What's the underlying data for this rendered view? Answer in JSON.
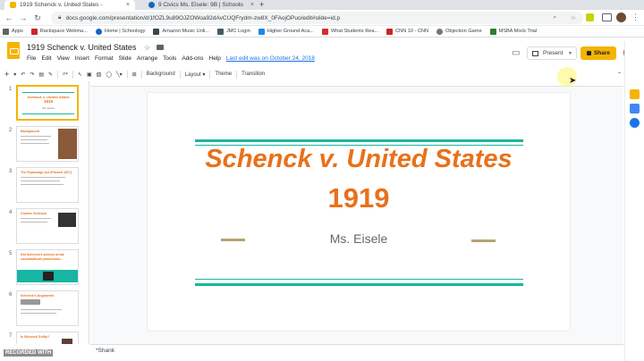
{
  "browser": {
    "tabs": [
      {
        "label": "1919 Schenck v. United States - ",
        "color": "#f4b400"
      },
      {
        "label": "9 Civics Ms. Eisele: 9B | Schoolo",
        "color": "#1565c0"
      }
    ],
    "new_tab": "+",
    "url": "docs.google.com/presentation/d/1fOZL9u89OJZOWoa92dAvCUQFrydm-zw8X_0FAojOPuo/edit#slide=id.p",
    "bookmarks": [
      {
        "label": "Apps",
        "color": "#5f6368"
      },
      {
        "label": "Rackspace Webma...",
        "color": "#c62828"
      },
      {
        "label": "Home | Schoology",
        "color": "#1565c0"
      },
      {
        "label": "Amazon Music Unli...",
        "color": "#37474f"
      },
      {
        "label": "JMC Login",
        "color": "#455a64"
      },
      {
        "label": "Higher Ground Aca...",
        "color": "#1e88e5"
      },
      {
        "label": "What Students Rea...",
        "color": "#d32f2f"
      },
      {
        "label": "CNN 10 - CNN",
        "color": "#c62828"
      },
      {
        "label": "Objection Game",
        "color": "#757575"
      },
      {
        "label": "MSBA Mock Trial",
        "color": "#2e7d32"
      }
    ]
  },
  "doc": {
    "title": "1919 Schenck v. United States",
    "menu": [
      "File",
      "Edit",
      "View",
      "Insert",
      "Format",
      "Slide",
      "Arrange",
      "Tools",
      "Add-ons",
      "Help"
    ],
    "last_edit": "Last edit was on October 24, 2018",
    "present_label": "Present",
    "share_label": "Share"
  },
  "toolbar": {
    "background": "Background",
    "layout": "Layout",
    "theme": "Theme",
    "transition": "Transition"
  },
  "filmstrip": [
    {
      "num": "1",
      "title": "Schenck v. United States 1919",
      "selected": true
    },
    {
      "num": "2",
      "title": "Background",
      "selected": false
    },
    {
      "num": "3",
      "title": "The Espionage Act (Passed 1917)",
      "selected": false
    },
    {
      "num": "4",
      "title": "Charles Schenck",
      "selected": false
    },
    {
      "num": "5",
      "title": "Did Schenck's actions break constitutional protections...",
      "selected": false
    },
    {
      "num": "6",
      "title": "Schenck's Arguments",
      "selected": false
    },
    {
      "num": "7",
      "title": "Is Schenck Guilty?",
      "selected": false
    }
  ],
  "slide": {
    "title": "Schenck v. United States",
    "year": "1919",
    "subtitle": "Ms. Eisele"
  },
  "notes": {
    "text": "*Shank"
  },
  "watermark": "RECORDED WITH",
  "colors": {
    "accent_orange": "#e8711a",
    "teal": "#17b6a2",
    "gold": "#b5a471",
    "share_yellow": "#f4b400"
  }
}
